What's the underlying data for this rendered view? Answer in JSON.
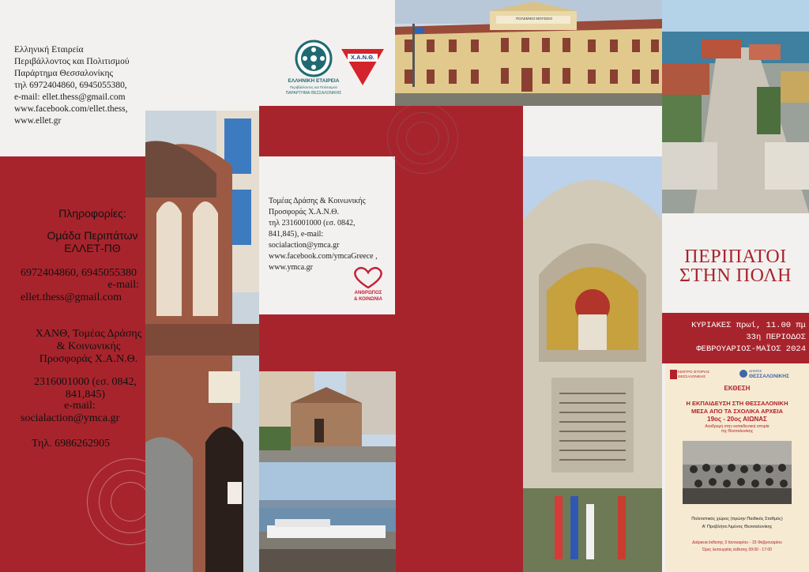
{
  "left_panel": {
    "org_lines": "Ελληνική Εταιρεία\nΠεριβάλλοντος και Πολιτισμού\nΠαράρτημα Θεσσαλονίκης\nτηλ 6972404860, 6945055380,\ne-mail: ellet.thess@gmail.com\nwww.facebook.com/ellet.thess,\nwww.ellet.gr",
    "info_heading": "Πληροφορίες:",
    "group_name": "Ομάδα Περιπάτων",
    "group_short": "ΕΛΛΕΤ-ΠΘ",
    "group_phone": "6972404860, 6945055380",
    "email_label_1": "e-mail:",
    "email_1": "ellet.thess@gmail.com",
    "xanth_sector": "ΧΑΝΘ, Τομέας Δράσης\n& Κοινωνικής\nΠροσφοράς Χ.Α.Ν.Θ.",
    "xanth_phone": "2316001000 (εσ. 0842,\n841,845)",
    "email_label_2": "e-mail:",
    "email_2": "socialaction@ymca.gr",
    "tel": "Τηλ. 6986262905"
  },
  "logos": {
    "ellet_line1": "ΕΛΛΗΝΙΚΗ ΕΤΑΙΡΕΙΑ",
    "ellet_line2": "Περιβάλλοντος και Πολιτισμού",
    "ellet_line3": "ΠΑΡΑΡΤΗΜΑ ΘΕΣΣΑΛΟΝΙΚΗΣ",
    "ymca": "Χ.Α.Ν.Θ.",
    "anthropos_1": "ΑΝΘΡΩΠΟΣ",
    "anthropos_2": "& ΚΟΙΝΩΝΙΑ"
  },
  "middle_panel": {
    "ymca_info": "Τομέας Δράσης & Κοινωνικής\nΠροσφοράς Χ.Α.Ν.Θ.\nτηλ 2316001000 (εσ. 0842,\n841,845), e-mail:\nsocialaction@ymca.gr\nwww.facebook.com/ymcaGreece ,\nwww.ymca.gr"
  },
  "photos": {
    "museum_sign": "ΠΟΛΕΜΙΚΟ ΜΟΥΣΕΙΟ"
  },
  "cover": {
    "title_line1": "ΠΕΡΙΠΑΤΟΙ",
    "title_line2": "ΣΤΗΝ ΠΟΛΗ",
    "schedule_1": "ΚΥΡΙΑΚΕΣ πρωί, 11.00 πμ",
    "schedule_2": "33η ΠΕΡΙΟΔΟΣ",
    "schedule_3": "ΦΕΒΡΟΥΑΡΙΟΣ-ΜΑΪΟΣ 2024"
  },
  "poster": {
    "logo_left": "ΚΕΝΤΡΟ ΙΣΤΟΡΙΑΣ\nΘΕΣΣΑΛΟΝΙΚΗΣ",
    "logo_right_small": "ΔΗΜΟΣ",
    "logo_right": "ΘΕΣΣΑΛΟΝΙΚΗΣ",
    "label": "ΕΚΘΕΣΗ",
    "title_1": "Η ΕΚΠΑΙΔΕΥΣΗ ΣΤΗ ΘΕΣΣΑΛΟΝΙΚΗ",
    "title_2": "ΜΕΣΑ ΑΠΟ ΤΑ ΣΧΟΛΙΚΑ ΑΡΧΕΙΑ",
    "title_3": "19ος - 20ος ΑΙΩΝΑΣ",
    "subtitle": "Αναδρομή στην εκπαιδευτική ιστορία\nτης Θεσσαλονίκης",
    "venue_1": "Πολιτιστικός χώρος (πρώην Παιδικός Σταθμός)",
    "venue_2": "Α' Προβλήτα Λιμένος Θεσσαλονίκης",
    "dates": "Διάρκεια έκθεσης 3 Ιανουαρίου - 15 Φεβρουαρίου",
    "hours": "Ώρες λειτουργίας έκθεσης 09:00 - 17:00"
  },
  "colors": {
    "brand_red": "#a8242c",
    "panel_light": "#f3f1ef",
    "poster_bg": "#f6ead3",
    "poster_red": "#b3202a"
  }
}
